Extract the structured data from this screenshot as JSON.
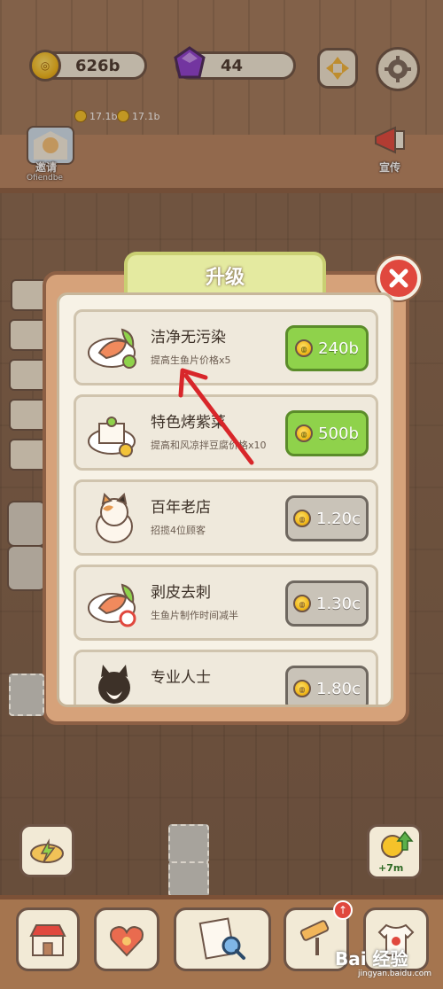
{
  "resources": {
    "coins": "626b",
    "gems": "44"
  },
  "scene": {
    "seat_income_1": "17.1b",
    "seat_income_2": "17.1b",
    "invite_label": "邀请",
    "invite_sub": "Ofiendbe",
    "promote_label": "宣传",
    "boost_label": "+7m"
  },
  "dialog": {
    "title": "升级",
    "items": [
      {
        "title": "洁净无污染",
        "desc": "提高生鱼片价格x5",
        "price": "240b",
        "state": "affordable"
      },
      {
        "title": "特色烤紫菜",
        "desc": "提高和风凉拌豆腐价格x10",
        "price": "500b",
        "state": "affordable"
      },
      {
        "title": "百年老店",
        "desc": "招揽4位顾客",
        "price": "1.20c",
        "state": "locked"
      },
      {
        "title": "剥皮去刺",
        "desc": "生鱼片制作时间减半",
        "price": "1.30c",
        "state": "locked"
      },
      {
        "title": "专业人士",
        "desc": "",
        "price": "1.80c",
        "state": "locked"
      }
    ]
  },
  "watermark": {
    "brand": "Bai 经验",
    "url": "jingyan.baidu.com"
  },
  "colors": {
    "green_button": "#8fd24b",
    "gray_button": "#c9c3b8",
    "close_red": "#e0483e",
    "arrow_red": "#d8262a"
  }
}
